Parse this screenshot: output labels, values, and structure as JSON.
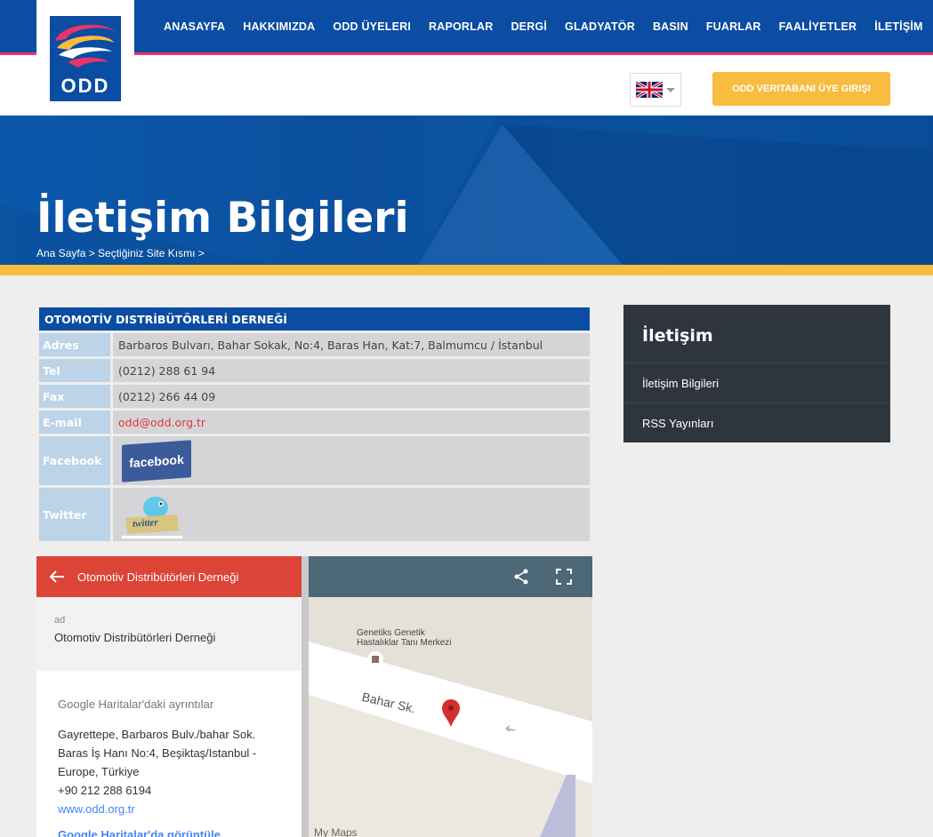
{
  "header": {
    "logo_text": "ODD",
    "nav": [
      "ANASAYFA",
      "HAKKIMIZDA",
      "ODD ÜYELERI",
      "RAPORLAR",
      "DERGİ",
      "GLADYATÖR",
      "BASIN",
      "FUARLAR",
      "FAALİYETLER",
      "İLETİŞİM"
    ],
    "login_label": "ODD VERITABANI ÜYE GIRIŞI"
  },
  "hero": {
    "title": "İletişim Bilgileri",
    "breadcrumb": "Ana Sayfa > Seçtiğiniz Site Kısmı >"
  },
  "contact_table": {
    "heading": "OTOMOTİV DISTRİBÜTÖRLERİ DERNEĞİ",
    "rows": [
      {
        "label": "Adres",
        "value": "Barbaros Bulvarı, Bahar Sokak, No:4, Baras Han, Kat:7, Balmumcu / İstanbul"
      },
      {
        "label": "Tel",
        "value": "(0212) 288 61 94"
      },
      {
        "label": "Fax",
        "value": "(0212) 266 44 09"
      },
      {
        "label": "E-mail",
        "value": "odd@odd.org.tr"
      },
      {
        "label": "Facebook",
        "value": "facebook"
      },
      {
        "label": "Twitter",
        "value": "twitter"
      }
    ]
  },
  "sidebar": {
    "title": "İletişim",
    "items": [
      "İletişim Bilgileri",
      "RSS Yayınları"
    ]
  },
  "map": {
    "header_title": "Otomotiv Distribütörleri Derneği",
    "ad_key": "ad",
    "ad_value": "Otomotiv Distribütörleri Derneği",
    "details_heading": "Google Haritalar'daki ayrıntılar",
    "address_lines": [
      "Gayrettepe, Barbaros Bulv./bahar Sok.",
      "Baras İş Hanı No:4, Beşiktaş/Istanbul -",
      "Europe, Türkiye",
      "+90 212 288 6194"
    ],
    "website": "www.odd.org.tr",
    "view_link": "Google Haritalar'da görüntüle",
    "poi_label_1": "Genetiks Genetik",
    "poi_label_2": "Hastalıklar Tanı Merkezi",
    "street": "Bahar Sk.",
    "watermark": "My Maps"
  },
  "colors": {
    "brand_blue": "#0a4da2",
    "accent_yellow": "#f8bc3f",
    "map_red": "#db4437"
  }
}
